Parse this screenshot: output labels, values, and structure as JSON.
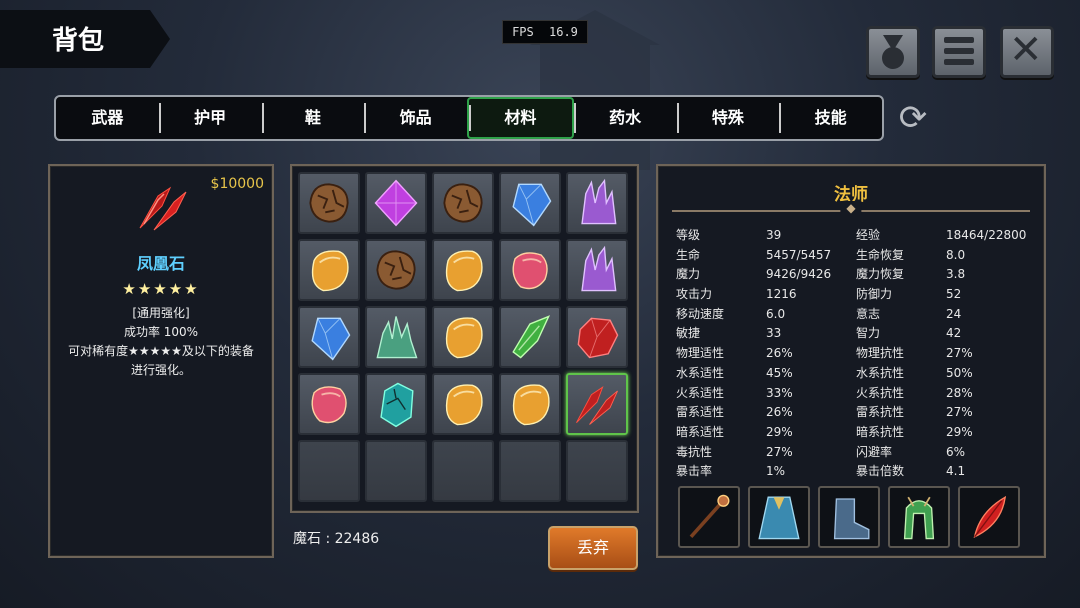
{
  "header": {
    "title": "背包",
    "fps_label": "FPS",
    "fps_value": "16.9"
  },
  "topbar": {
    "medal_icon": "medal-icon",
    "menu_icon": "menu-icon",
    "close_icon": "close-icon"
  },
  "tabs": [
    {
      "label": "武器",
      "active": false
    },
    {
      "label": "护甲",
      "active": false
    },
    {
      "label": "鞋",
      "active": false
    },
    {
      "label": "饰品",
      "active": false
    },
    {
      "label": "材料",
      "active": true
    },
    {
      "label": "药水",
      "active": false
    },
    {
      "label": "特殊",
      "active": false
    },
    {
      "label": "技能",
      "active": false
    }
  ],
  "detail": {
    "price": "$10000",
    "name": "凤凰石",
    "stars": "★★★★★",
    "line1": "[通用强化]",
    "line2": "成功率  100%",
    "line3": "可对稀有度★★★★★及以下的装备",
    "line4": "进行强化。"
  },
  "inventory": [
    {
      "icon": "brown-rock",
      "color": "#8a5a32"
    },
    {
      "icon": "purple-diamond",
      "color": "#c040e0"
    },
    {
      "icon": "brown-rock",
      "color": "#8a5a32"
    },
    {
      "icon": "blue-crystal",
      "color": "#3a7fe0"
    },
    {
      "icon": "amethyst-cluster",
      "color": "#9a5ad0"
    },
    {
      "icon": "amber-gem",
      "color": "#e8a030"
    },
    {
      "icon": "brown-rock",
      "color": "#8a5a32"
    },
    {
      "icon": "amber-gem",
      "color": "#e8a030"
    },
    {
      "icon": "rose-gem",
      "color": "#e05070"
    },
    {
      "icon": "amethyst-cluster",
      "color": "#9a5ad0"
    },
    {
      "icon": "blue-crystal",
      "color": "#3a7fe0"
    },
    {
      "icon": "green-crystal-cluster",
      "color": "#4aa080"
    },
    {
      "icon": "amber-gem",
      "color": "#e8a030"
    },
    {
      "icon": "emerald-shard",
      "color": "#40b040"
    },
    {
      "icon": "red-ruby",
      "color": "#c02020"
    },
    {
      "icon": "rose-gem",
      "color": "#e05070"
    },
    {
      "icon": "teal-stone",
      "color": "#20a0a0"
    },
    {
      "icon": "amber-gem",
      "color": "#e8a030"
    },
    {
      "icon": "amber-gem",
      "color": "#e8a030"
    },
    {
      "icon": "phoenix-stone",
      "color": "#c02020",
      "selected": true
    },
    {
      "icon": "empty"
    },
    {
      "icon": "empty"
    },
    {
      "icon": "empty"
    },
    {
      "icon": "empty"
    },
    {
      "icon": "empty"
    }
  ],
  "footer": {
    "magic_stone": "魔石 : 22486",
    "drop_label": "丢弃"
  },
  "character": {
    "class": "法师",
    "stats": [
      [
        "等级",
        "39",
        "经验",
        "18464/22800"
      ],
      [
        "生命",
        "5457/5457",
        "生命恢复",
        "8.0"
      ],
      [
        "魔力",
        "9426/9426",
        "魔力恢复",
        "3.8"
      ],
      [
        "攻击力",
        "1216",
        "防御力",
        "52"
      ],
      [
        "移动速度",
        "6.0",
        "意志",
        "24"
      ],
      [
        "敏捷",
        "33",
        "智力",
        "42"
      ],
      [
        "物理适性",
        "26%",
        "物理抗性",
        "27%"
      ],
      [
        "水系适性",
        "45%",
        "水系抗性",
        "50%"
      ],
      [
        "火系适性",
        "33%",
        "火系抗性",
        "28%"
      ],
      [
        "雷系适性",
        "26%",
        "雷系抗性",
        "27%"
      ],
      [
        "暗系适性",
        "29%",
        "暗系抗性",
        "29%"
      ],
      [
        "毒抗性",
        "27%",
        "闪避率",
        "6%"
      ],
      [
        "暴击率",
        "1%",
        "暴击倍数",
        "4.1"
      ]
    ],
    "equipment": [
      {
        "icon": "staff-icon",
        "color": "#c07040"
      },
      {
        "icon": "robe-icon",
        "color": "#3a8ab0"
      },
      {
        "icon": "boots-icon",
        "color": "#4a6a8a"
      },
      {
        "icon": "hood-icon",
        "color": "#40a050"
      },
      {
        "icon": "feather-icon",
        "color": "#d02020"
      }
    ]
  }
}
